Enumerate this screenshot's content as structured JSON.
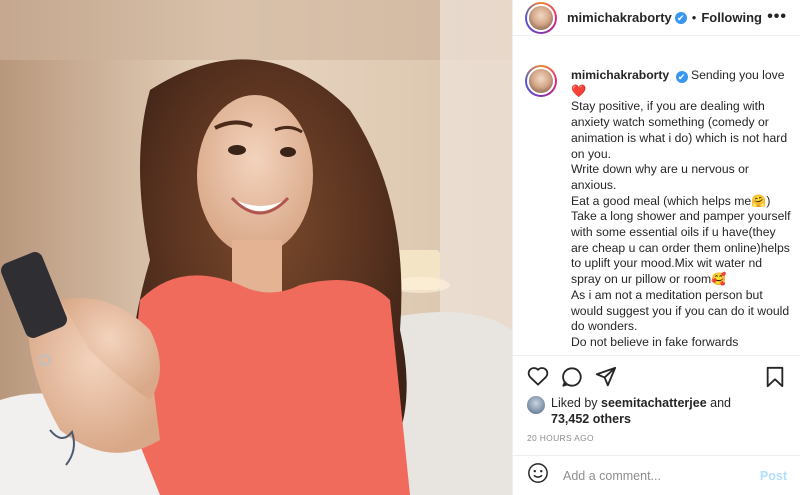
{
  "photo": {
    "description_icon": "post-photo"
  },
  "header": {
    "username": "mimichakraborty",
    "verified_mark": "✔",
    "separator": "•",
    "follow_status": "Following",
    "more": "•••"
  },
  "caption": {
    "username": "mimichakraborty",
    "verified_mark": "✔",
    "text": " Sending you love\n❤️\nStay positive, if you are dealing with anxiety watch something (comedy or animation is what i do) which is not hard on you.\nWrite down why are u nervous or anxious.\nEat a good meal (which helps me🤗)\nTake a long shower and pamper yourself with some essential oils if u have(they are cheap u can order them online)helps to uplift your mood.Mix wit water nd spray on ur pillow or room🥰\nAs i am not a meditation person but would suggest you if you can do it would do wonders.\nDo not believe in fake forwards"
  },
  "likes": {
    "prefix": "Liked by ",
    "user": "seemitachatterjee",
    "middle": " and",
    "count": "73,452 others"
  },
  "timestamp": "20 HOURS AGO",
  "comment": {
    "placeholder": "Add a comment...",
    "post_label": "Post"
  },
  "colors": {
    "verified": "#3897f0",
    "post_disabled": "#b2dffc",
    "heart": "#ed4956"
  }
}
